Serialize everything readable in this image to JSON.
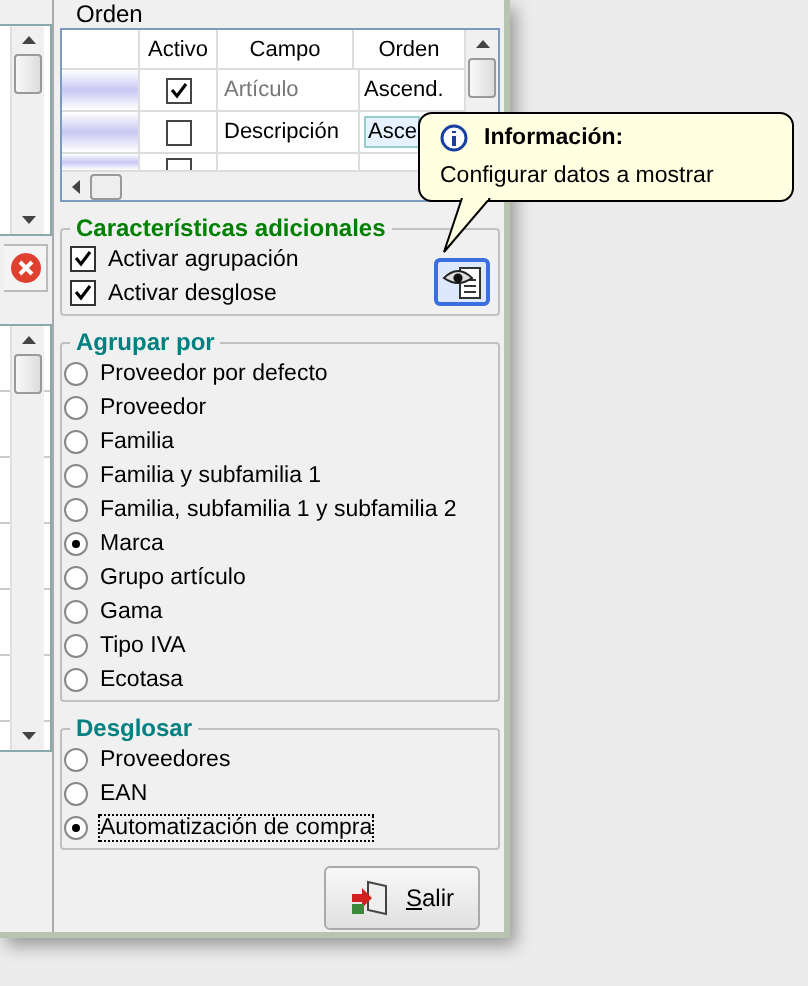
{
  "order_group": {
    "title": "Orden"
  },
  "order_grid": {
    "columns": [
      "Activo",
      "Campo",
      "Orden"
    ],
    "rows": [
      {
        "active": true,
        "field": "Artículo",
        "order": "Ascend.",
        "dimmed": true,
        "editing": false
      },
      {
        "active": false,
        "field": "Descripción",
        "order": "Asce",
        "dimmed": false,
        "editing": true
      },
      {
        "active": false
      }
    ]
  },
  "tooltip": {
    "title": "Información:",
    "text": "Configurar datos a mostrar"
  },
  "extras": {
    "title": "Características adicionales",
    "options": [
      {
        "label": "Activar agrupación",
        "checked": true
      },
      {
        "label": "Activar desglose",
        "checked": true
      }
    ]
  },
  "group_by": {
    "title": "Agrupar por",
    "options": [
      {
        "label": "Proveedor por defecto",
        "selected": false
      },
      {
        "label": "Proveedor",
        "selected": false
      },
      {
        "label": "Familia",
        "selected": false
      },
      {
        "label": "Familia y subfamilia 1",
        "selected": false
      },
      {
        "label": "Familia, subfamilia 1 y subfamilia 2",
        "selected": false
      },
      {
        "label": "Marca",
        "selected": true
      },
      {
        "label": "Grupo artículo",
        "selected": false
      },
      {
        "label": "Gama",
        "selected": false
      },
      {
        "label": "Tipo IVA",
        "selected": false
      },
      {
        "label": "Ecotasa",
        "selected": false
      }
    ]
  },
  "breakdown": {
    "title": "Desglosar",
    "options": [
      {
        "label": "Proveedores",
        "selected": false,
        "focused": false
      },
      {
        "label": "EAN",
        "selected": false,
        "focused": false
      },
      {
        "label": "Automatización de compra",
        "selected": true,
        "focused": true
      }
    ]
  },
  "exit_button": {
    "label": "Salir"
  }
}
